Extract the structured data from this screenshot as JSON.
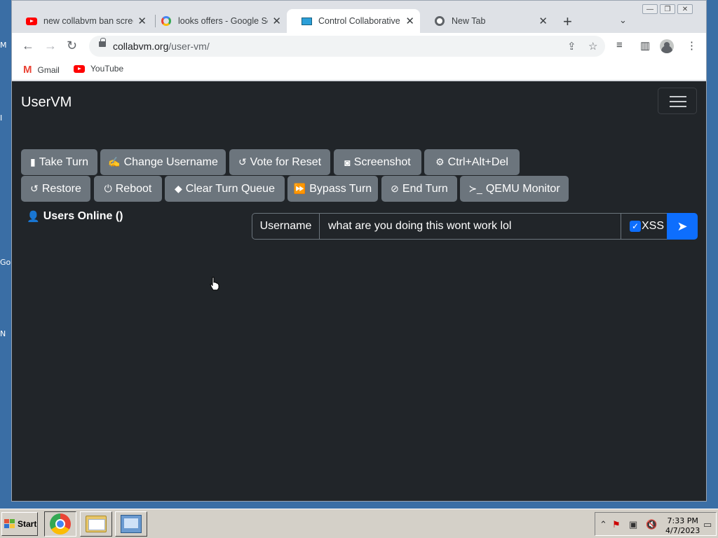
{
  "desktop": {
    "labels": [
      "M",
      "I",
      "Go",
      "N"
    ]
  },
  "browser": {
    "tabs": [
      {
        "title": "new collabvm ban scree",
        "icon": "youtube-icon",
        "active": false
      },
      {
        "title": "looks offers - Google Se",
        "icon": "google-icon",
        "active": false
      },
      {
        "title": "Control Collaborative Vi",
        "icon": "monitor-icon",
        "active": true
      },
      {
        "title": "New Tab",
        "icon": "chrome-icon",
        "active": false
      }
    ],
    "url_host": "collabvm.org",
    "url_path": "/user-vm/",
    "bookmarks": [
      {
        "label": "Gmail",
        "icon": "gmail-icon"
      },
      {
        "label": "YouTube",
        "icon": "youtube-icon"
      }
    ]
  },
  "page": {
    "brand": "UserVM",
    "buttons_row1": [
      {
        "label": "Take Turn",
        "icon": "mouse-icon"
      },
      {
        "label": "Change Username",
        "icon": "signature-icon"
      },
      {
        "label": "Vote for Reset",
        "icon": "undo-icon"
      },
      {
        "label": "Screenshot",
        "icon": "camera-icon"
      },
      {
        "label": "Ctrl+Alt+Del",
        "icon": "gear-icon"
      }
    ],
    "buttons_row2": [
      {
        "label": "Restore",
        "icon": "undo-icon"
      },
      {
        "label": "Reboot",
        "icon": "power-icon"
      },
      {
        "label": "Clear Turn Queue",
        "icon": "eraser-icon"
      },
      {
        "label": "Bypass Turn",
        "icon": "fast-forward-icon"
      },
      {
        "label": "End Turn",
        "icon": "ban-icon"
      },
      {
        "label": "QEMU Monitor",
        "icon": "terminal-icon"
      }
    ],
    "users_online": "Users Online ()",
    "chat": {
      "username_label": "Username",
      "input_value": "what are you doing this wont work lol",
      "xss_label": "XSS",
      "xss_checked": true
    }
  },
  "taskbar": {
    "start_label": "Start",
    "time": "7:33 PM",
    "date": "4/7/2023"
  }
}
